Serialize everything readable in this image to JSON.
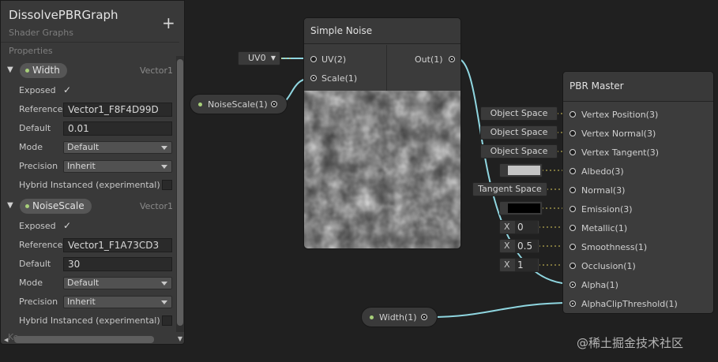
{
  "blackboard": {
    "title": "DissolvePBRGraph",
    "subtitle": "Shader Graphs",
    "add_symbol": "+",
    "section_label": "Properties",
    "labels": {
      "exposed": "Exposed",
      "reference": "Reference",
      "default": "Default",
      "mode": "Mode",
      "precision": "Precision",
      "hybrid": "Hybrid Instanced (experimental)"
    },
    "checkmark": "✓",
    "properties": [
      {
        "name": "Width",
        "type": "Vector1",
        "exposed": true,
        "reference": "Vector1_F8F4D99D",
        "default": "0.01",
        "mode": "Default",
        "precision": "Inherit"
      },
      {
        "name": "NoiseScale",
        "type": "Vector1",
        "exposed": true,
        "reference": "Vector1_F1A73CD3",
        "default": "30",
        "mode": "Default",
        "precision": "Inherit"
      }
    ],
    "truncated_footer": "Ke"
  },
  "graph": {
    "uv_dropdown": "UV0",
    "noise_scale_node": "NoiseScale(1)",
    "width_node": "Width(1)",
    "simple_noise": {
      "title": "Simple Noise",
      "inputs": [
        "UV(2)",
        "Scale(1)"
      ],
      "output": "Out(1)"
    },
    "pbr_master": {
      "title": "PBR Master",
      "ports": [
        "Vertex Position(3)",
        "Vertex Normal(3)",
        "Vertex Tangent(3)",
        "Albedo(3)",
        "Normal(3)",
        "Emission(3)",
        "Metallic(1)",
        "Smoothness(1)",
        "Occlusion(1)",
        "Alpha(1)",
        "AlphaClipThreshold(1)"
      ]
    },
    "inline_inputs": {
      "vertex_position": "Object Space",
      "vertex_normal": "Object Space",
      "vertex_tangent": "Object Space",
      "normal": "Tangent Space",
      "metallic_axis": "X",
      "metallic": "0",
      "smoothness_axis": "X",
      "smoothness": "0.5",
      "occlusion_axis": "X",
      "occlusion": "1"
    },
    "albedo_color": "#c4c4c4",
    "emission_color": "#000000",
    "wire_color": "#8fd6e0",
    "property_dot_color": "#a8d07a"
  },
  "watermark": "@稀土掘金技术社区"
}
